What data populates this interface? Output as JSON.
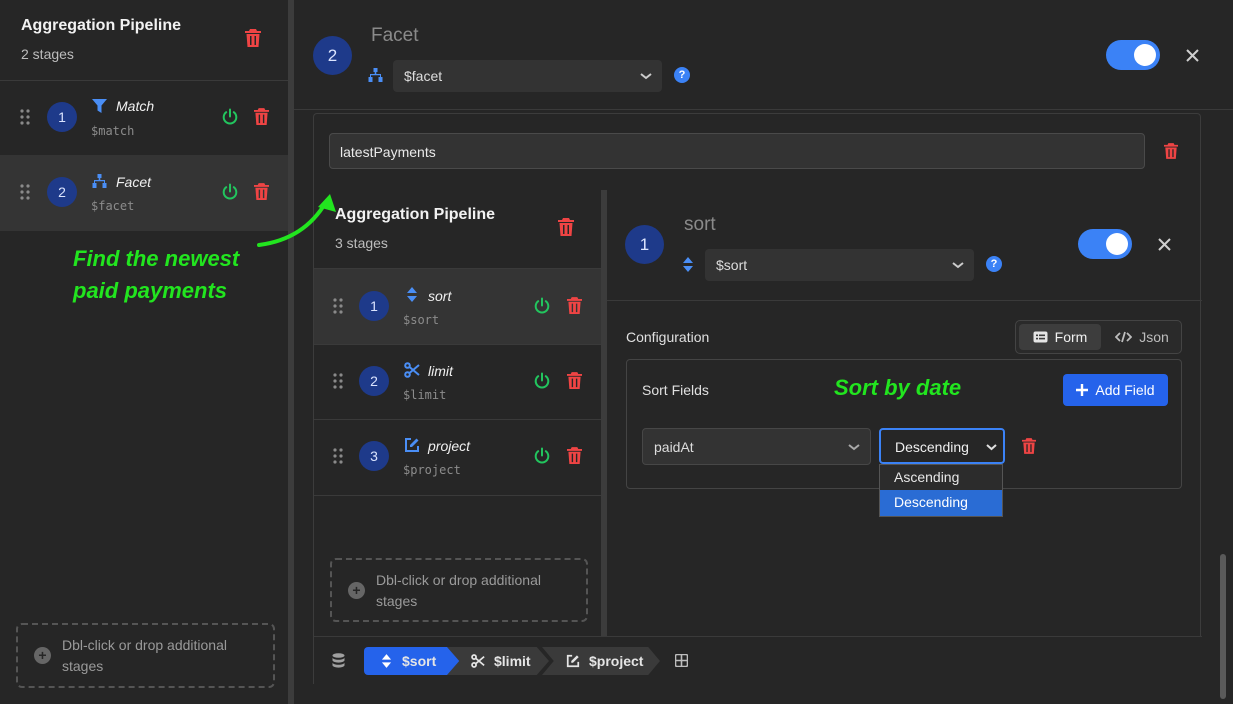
{
  "left_panel": {
    "title": "Aggregation Pipeline",
    "subtitle": "2 stages",
    "stages": [
      {
        "num": "1",
        "name": "Match",
        "op": "$match"
      },
      {
        "num": "2",
        "name": "Facet",
        "op": "$facet"
      }
    ],
    "dropzone": "Dbl-click or drop additional stages"
  },
  "annotations": {
    "left": "Find the newest paid payments",
    "sort": "Sort by date"
  },
  "header": {
    "stage_num": "2",
    "stage_title": "Facet",
    "operator": "$facet",
    "help": "?"
  },
  "facet": {
    "field_name": "latestPayments"
  },
  "inner_panel": {
    "title": "Aggregation Pipeline",
    "subtitle": "3 stages",
    "stages": [
      {
        "num": "1",
        "name": "sort",
        "op": "$sort"
      },
      {
        "num": "2",
        "name": "limit",
        "op": "$limit"
      },
      {
        "num": "3",
        "name": "project",
        "op": "$project"
      }
    ],
    "dropzone": "Dbl-click or drop additional stages"
  },
  "inner_header": {
    "stage_num": "1",
    "stage_title": "sort",
    "operator": "$sort",
    "help": "?"
  },
  "config": {
    "label": "Configuration",
    "form_tab": "Form",
    "json_tab": "Json",
    "sort_fields_label": "Sort Fields",
    "add_field": "Add Field",
    "field_value": "paidAt",
    "direction_value": "Descending",
    "direction_options": [
      "Ascending",
      "Descending"
    ],
    "selected_option": "Descending"
  },
  "breadcrumbs": [
    "$sort",
    "$limit",
    "$project"
  ],
  "colors": {
    "accent": "#2563eb",
    "toggle": "#3b82f6",
    "danger": "#ef4444",
    "success": "#22c55e",
    "annotation": "#22e51f"
  }
}
